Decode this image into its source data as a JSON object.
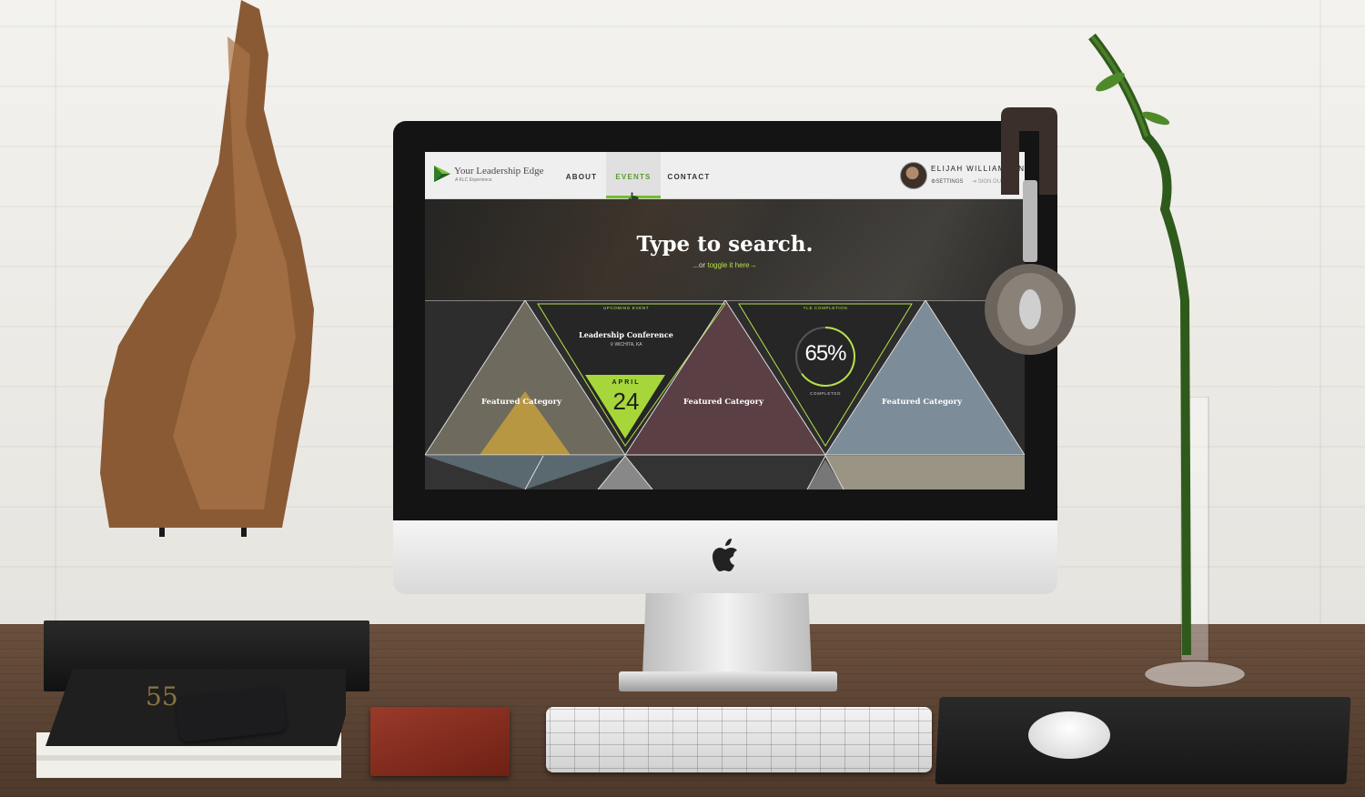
{
  "site": {
    "logo_title": "Your Leadership Edge",
    "logo_subtitle": "A KLC Experience"
  },
  "nav": {
    "items": [
      {
        "label": "ABOUT",
        "active": false
      },
      {
        "label": "EVENTS",
        "active": true
      },
      {
        "label": "CONTACT",
        "active": false
      }
    ]
  },
  "user": {
    "name": "ELIJAH WILLIAMSON",
    "settings_label": "SETTINGS",
    "signout_label": "SIGN OUT"
  },
  "hero": {
    "title": "Type to search.",
    "sub_prefix": "...or ",
    "sub_link": "toggle it here",
    "sub_arrow": "→"
  },
  "tiles": {
    "featured_label": "Featured Category",
    "upcoming": {
      "heading": "UPCOMING EVENT",
      "name": "Leadership Conference",
      "location": "WICHITA, KA",
      "month": "APRIL",
      "day": "24"
    },
    "completion": {
      "heading": "YLE COMPLETION",
      "percent_text": "65%",
      "percent": 65,
      "caption": "COMPLETED"
    }
  },
  "colors": {
    "accent_green": "#b6e04a",
    "nav_active": "#5a9c2a",
    "tile_dark": "#2d2d2d"
  },
  "icons": [
    "logo-triangle-icon",
    "cursor-hand-icon",
    "gear-icon",
    "sign-out-icon",
    "location-pin-icon",
    "apple-logo-icon"
  ]
}
